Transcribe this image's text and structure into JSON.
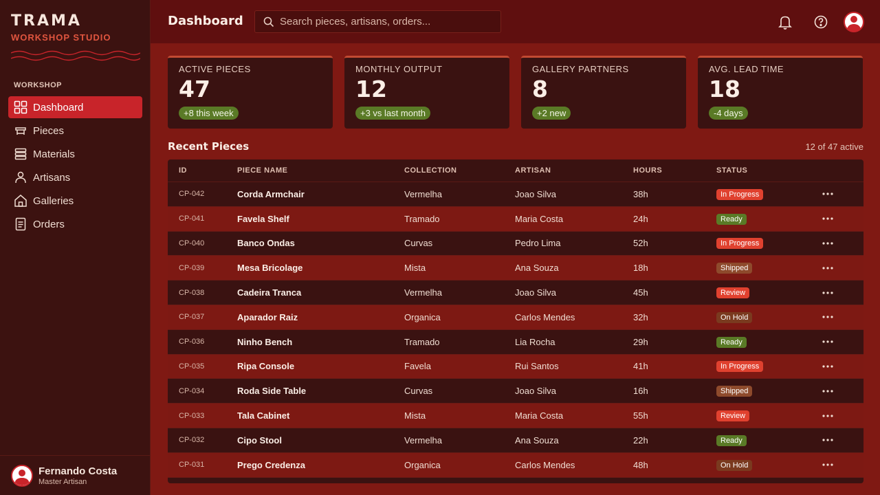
{
  "brand": {
    "title": "TRAMA",
    "subtitle": "WORKSHOP STUDIO"
  },
  "sidebar": {
    "heading": "WORKSHOP",
    "items": [
      {
        "label": "Dashboard",
        "icon": "grid-icon",
        "active": true
      },
      {
        "label": "Pieces",
        "icon": "furniture-icon",
        "active": false
      },
      {
        "label": "Materials",
        "icon": "layers-icon",
        "active": false
      },
      {
        "label": "Artisans",
        "icon": "user-icon",
        "active": false
      },
      {
        "label": "Galleries",
        "icon": "home-icon",
        "active": false
      },
      {
        "label": "Orders",
        "icon": "document-icon",
        "active": false
      }
    ],
    "user": {
      "name": "Fernando Costa",
      "role": "Master Artisan"
    }
  },
  "header": {
    "title": "Dashboard",
    "search_placeholder": "Search pieces, artisans, orders..."
  },
  "stats": [
    {
      "label": "ACTIVE PIECES",
      "value": "47",
      "badge": "+8 this week"
    },
    {
      "label": "MONTHLY OUTPUT",
      "value": "12",
      "badge": "+3 vs last month"
    },
    {
      "label": "GALLERY PARTNERS",
      "value": "8",
      "badge": "+2 new"
    },
    {
      "label": "AVG. LEAD TIME",
      "value": "18",
      "badge": "-4 days"
    }
  ],
  "section": {
    "title": "Recent Pieces",
    "meta": "12 of 47 active"
  },
  "table": {
    "columns": [
      "ID",
      "PIECE NAME",
      "COLLECTION",
      "ARTISAN",
      "HOURS",
      "STATUS"
    ],
    "rows": [
      {
        "id": "CP-042",
        "name": "Corda Armchair",
        "collection": "Vermelha",
        "artisan": "Joao Silva",
        "hours": "38h",
        "status": "In Progress",
        "status_key": "inprogress"
      },
      {
        "id": "CP-041",
        "name": "Favela Shelf",
        "collection": "Tramado",
        "artisan": "Maria Costa",
        "hours": "24h",
        "status": "Ready",
        "status_key": "ready"
      },
      {
        "id": "CP-040",
        "name": "Banco Ondas",
        "collection": "Curvas",
        "artisan": "Pedro Lima",
        "hours": "52h",
        "status": "In Progress",
        "status_key": "inprogress"
      },
      {
        "id": "CP-039",
        "name": "Mesa Bricolage",
        "collection": "Mista",
        "artisan": "Ana Souza",
        "hours": "18h",
        "status": "Shipped",
        "status_key": "shipped"
      },
      {
        "id": "CP-038",
        "name": "Cadeira Tranca",
        "collection": "Vermelha",
        "artisan": "Joao Silva",
        "hours": "45h",
        "status": "Review",
        "status_key": "review"
      },
      {
        "id": "CP-037",
        "name": "Aparador Raiz",
        "collection": "Organica",
        "artisan": "Carlos Mendes",
        "hours": "32h",
        "status": "On Hold",
        "status_key": "onhold"
      },
      {
        "id": "CP-036",
        "name": "Ninho Bench",
        "collection": "Tramado",
        "artisan": "Lia Rocha",
        "hours": "29h",
        "status": "Ready",
        "status_key": "ready"
      },
      {
        "id": "CP-035",
        "name": "Ripa Console",
        "collection": "Favela",
        "artisan": "Rui Santos",
        "hours": "41h",
        "status": "In Progress",
        "status_key": "inprogress"
      },
      {
        "id": "CP-034",
        "name": "Roda Side Table",
        "collection": "Curvas",
        "artisan": "Joao Silva",
        "hours": "16h",
        "status": "Shipped",
        "status_key": "shipped"
      },
      {
        "id": "CP-033",
        "name": "Tala Cabinet",
        "collection": "Mista",
        "artisan": "Maria Costa",
        "hours": "55h",
        "status": "Review",
        "status_key": "review"
      },
      {
        "id": "CP-032",
        "name": "Cipo Stool",
        "collection": "Vermelha",
        "artisan": "Ana Souza",
        "hours": "22h",
        "status": "Ready",
        "status_key": "ready"
      },
      {
        "id": "CP-031",
        "name": "Prego Credenza",
        "collection": "Organica",
        "artisan": "Carlos Mendes",
        "hours": "48h",
        "status": "On Hold",
        "status_key": "onhold"
      }
    ]
  },
  "colors": {
    "accent": "#c8242a",
    "sidebar_bg": "#3c1210",
    "page_bg": "#7f1913",
    "badge_green": "#5a7a26",
    "badge_red": "#e0412f",
    "badge_brown": "#8e4a2c"
  }
}
